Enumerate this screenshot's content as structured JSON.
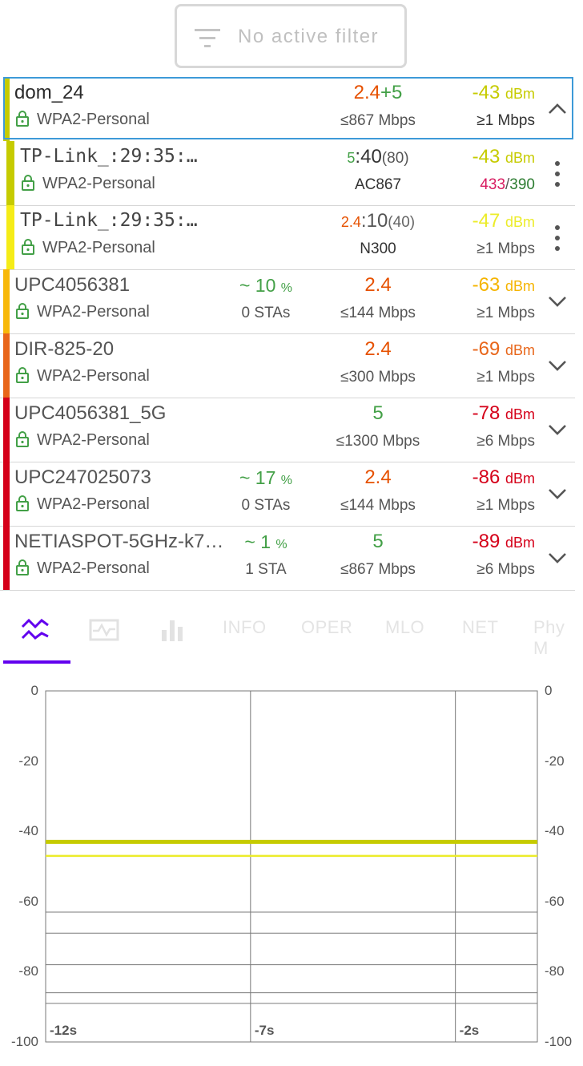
{
  "filter": {
    "label": "No active filter",
    "icon": "filter-icon"
  },
  "networks": [
    {
      "ssid": "dom_24",
      "security": "WPA2-Personal",
      "quality": "",
      "quality_unit": "",
      "stations": "",
      "band_parts": [
        {
          "text": "2.4",
          "color": "#e65100"
        },
        {
          "text": "+",
          "color": "#43a047"
        },
        {
          "text": "5",
          "color": "#43a047"
        }
      ],
      "rate": "≤867 Mbps",
      "signal": "-43",
      "signal_unit": "dBm",
      "signal_color": "#c6cb00",
      "min_parts": [
        {
          "text": "≥1 Mbps",
          "color": "#333333"
        }
      ],
      "bar_color": "#c6cb00",
      "icon": "chevron-up-icon",
      "selected": true,
      "sub": false
    },
    {
      "ssid": "TP-Link_:29:35:…",
      "security": "WPA2-Personal",
      "quality": "",
      "quality_unit": "",
      "stations": "",
      "band_parts": [
        {
          "text": "5",
          "color": "#43a047"
        },
        {
          "text": ":40",
          "color": "#333333"
        },
        {
          "text": "(80)",
          "color": "#555555"
        }
      ],
      "rate": "AC867",
      "signal": "-43",
      "signal_unit": "dBm",
      "signal_color": "#c6cb00",
      "min_parts": [
        {
          "text": "433",
          "color": "#d81b60"
        },
        {
          "text": "/",
          "color": "#555555"
        },
        {
          "text": "390",
          "color": "#2e7d32"
        }
      ],
      "bar_color": "#c6cb00",
      "icon": "more-vert-icon",
      "selected": false,
      "sub": true
    },
    {
      "ssid": "TP-Link_:29:35:…",
      "security": "WPA2-Personal",
      "quality": "",
      "quality_unit": "",
      "stations": "",
      "band_parts": [
        {
          "text": "2.4",
          "color": "#e65100"
        },
        {
          "text": ":10",
          "color": "#555555"
        },
        {
          "text": "(40)",
          "color": "#666666"
        }
      ],
      "rate": "N300",
      "signal": "-47",
      "signal_unit": "dBm",
      "signal_color": "#ecec2a",
      "min_parts": [
        {
          "text": "≥1 Mbps",
          "color": "#555555"
        }
      ],
      "bar_color": "#f5ec17",
      "icon": "more-vert-icon",
      "selected": false,
      "sub": true
    },
    {
      "ssid": "UPC4056381",
      "security": "WPA2-Personal",
      "quality": "~ 10",
      "quality_unit": "%",
      "stations": "0 STAs",
      "band_parts": [
        {
          "text": "2.4",
          "color": "#e65100"
        }
      ],
      "rate": "≤144 Mbps",
      "signal": "-63",
      "signal_unit": "dBm",
      "signal_color": "#f5b400",
      "min_parts": [
        {
          "text": "≥1 Mbps",
          "color": "#555555"
        }
      ],
      "bar_color": "#f7b80a",
      "icon": "chevron-down-icon",
      "selected": false,
      "sub": false
    },
    {
      "ssid": "DIR-825-20",
      "security": "WPA2-Personal",
      "quality": "",
      "quality_unit": "",
      "stations": "",
      "band_parts": [
        {
          "text": "2.4",
          "color": "#e65100"
        }
      ],
      "rate": "≤300 Mbps",
      "signal": "-69",
      "signal_unit": "dBm",
      "signal_color": "#e8661a",
      "min_parts": [
        {
          "text": "≥1 Mbps",
          "color": "#555555"
        }
      ],
      "bar_color": "#e8661a",
      "icon": "chevron-down-icon",
      "selected": false,
      "sub": false
    },
    {
      "ssid": "UPC4056381_5G",
      "security": "WPA2-Personal",
      "quality": "",
      "quality_unit": "",
      "stations": "",
      "band_parts": [
        {
          "text": "5",
          "color": "#43a047"
        }
      ],
      "rate": "≤1300 Mbps",
      "signal": "-78",
      "signal_unit": "dBm",
      "signal_color": "#d50019",
      "min_parts": [
        {
          "text": "≥6 Mbps",
          "color": "#555555"
        }
      ],
      "bar_color": "#d50019",
      "icon": "chevron-down-icon",
      "selected": false,
      "sub": false
    },
    {
      "ssid": "UPC247025073",
      "security": "WPA2-Personal",
      "quality": "~ 17",
      "quality_unit": "%",
      "stations": "0 STAs",
      "band_parts": [
        {
          "text": "2.4",
          "color": "#e65100"
        }
      ],
      "rate": "≤144 Mbps",
      "signal": "-86",
      "signal_unit": "dBm",
      "signal_color": "#d50019",
      "min_parts": [
        {
          "text": "≥1 Mbps",
          "color": "#555555"
        }
      ],
      "bar_color": "#d50019",
      "icon": "chevron-down-icon",
      "selected": false,
      "sub": false
    },
    {
      "ssid": "NETIASPOT-5GHz-k7…",
      "security": "WPA2-Personal",
      "quality": "~ 1",
      "quality_unit": "%",
      "stations": "1 STA",
      "band_parts": [
        {
          "text": "5",
          "color": "#43a047"
        }
      ],
      "rate": "≤867 Mbps",
      "signal": "-89",
      "signal_unit": "dBm",
      "signal_color": "#d50019",
      "min_parts": [
        {
          "text": "≥6 Mbps",
          "color": "#555555"
        }
      ],
      "bar_color": "#d50019",
      "icon": "chevron-down-icon",
      "selected": false,
      "sub": false
    }
  ],
  "tabs": [
    {
      "type": "icon",
      "icon": "signal-time-graph-icon",
      "active": true
    },
    {
      "type": "icon",
      "icon": "channel-graph-icon",
      "active": false
    },
    {
      "type": "icon",
      "icon": "bar-chart-icon",
      "active": false
    },
    {
      "type": "text",
      "label": "INFO",
      "active": false
    },
    {
      "type": "text",
      "label": "OPER",
      "active": false
    },
    {
      "type": "text",
      "label": "MLO",
      "active": false
    },
    {
      "type": "text",
      "label": "NET",
      "active": false
    },
    {
      "type": "text",
      "label": "Phy M",
      "active": false
    }
  ],
  "colors": {
    "accent": "#6200ee",
    "selection": "#3d9ad8",
    "grid": "#777777"
  },
  "chart_data": {
    "type": "line",
    "ylim": [
      -100,
      0
    ],
    "yticks": [
      "0",
      "-20",
      "-40",
      "-60",
      "-80",
      "-100"
    ],
    "ytick_values": [
      0,
      -20,
      -40,
      -60,
      -80,
      -100
    ],
    "xlim": [
      -12,
      0
    ],
    "xticks": [
      "-12s",
      "-7s",
      "-2s"
    ],
    "xtick_values": [
      -12,
      -7,
      -2
    ],
    "grid": true,
    "series": [
      {
        "color": "#c6cb00",
        "x": [
          -12,
          0
        ],
        "y": [
          -43,
          -43
        ],
        "thick": true
      },
      {
        "color": "#ecec2a",
        "x": [
          -12,
          0
        ],
        "y": [
          -47,
          -47
        ],
        "thick": false
      },
      {
        "color": "#7a7a7a",
        "x": [
          -12,
          0
        ],
        "y": [
          -63,
          -63
        ],
        "thick": false
      },
      {
        "color": "#7a7a7a",
        "x": [
          -12,
          0
        ],
        "y": [
          -69,
          -69
        ],
        "thick": false
      },
      {
        "color": "#7a7a7a",
        "x": [
          -12,
          0
        ],
        "y": [
          -78,
          -78
        ],
        "thick": false
      },
      {
        "color": "#7a7a7a",
        "x": [
          -12,
          0
        ],
        "y": [
          -86,
          -86
        ],
        "thick": false
      },
      {
        "color": "#7a7a7a",
        "x": [
          -12,
          0
        ],
        "y": [
          -89,
          -89
        ],
        "thick": false
      }
    ]
  }
}
